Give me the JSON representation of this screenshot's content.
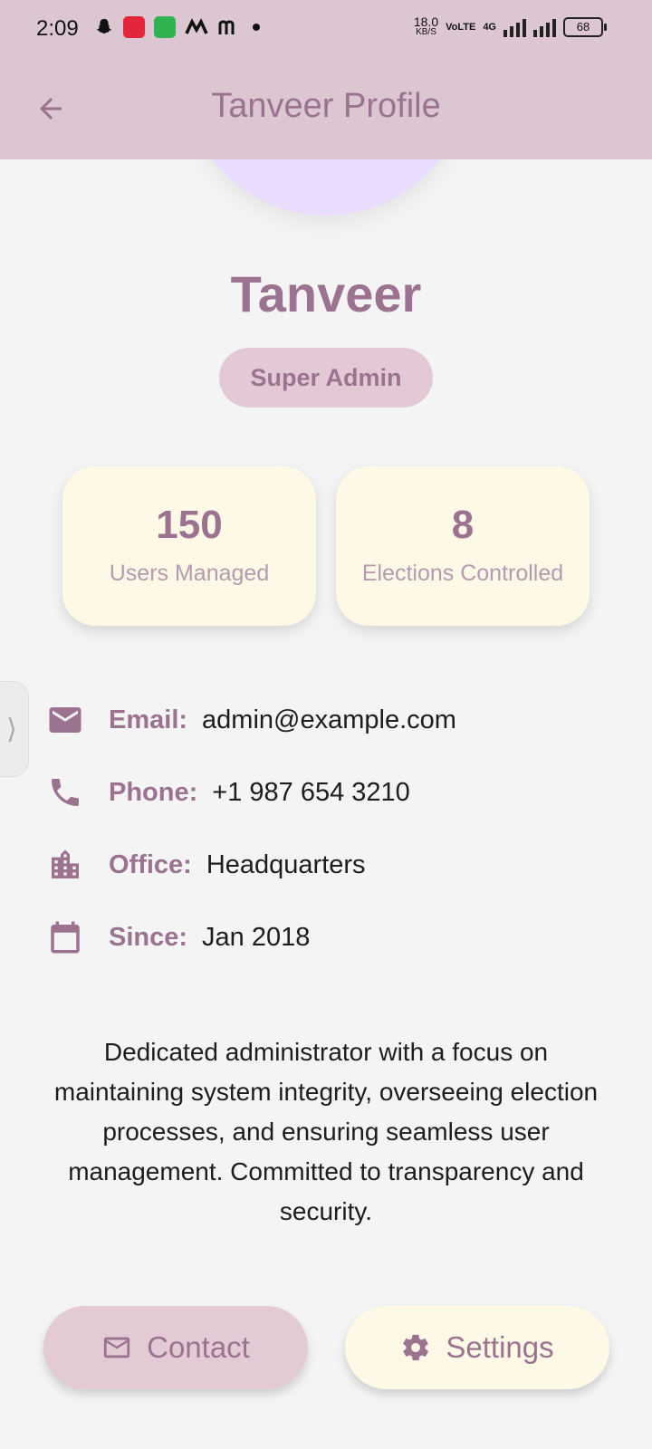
{
  "status_bar": {
    "time": "2:09",
    "speed": "18.0",
    "speed_unit": "KB/S",
    "volte": "VoLTE",
    "network": "4G",
    "battery": "68"
  },
  "app_bar": {
    "title": "Tanveer Profile",
    "background": "#dcc6d1"
  },
  "profile": {
    "name": "Tanveer",
    "role": "Super Admin"
  },
  "stats": [
    {
      "value": "150",
      "label": "Users Managed"
    },
    {
      "value": "8",
      "label": "Elections Controlled"
    }
  ],
  "info": [
    {
      "icon": "email-icon",
      "label": "Email:",
      "value": "admin@example.com"
    },
    {
      "icon": "phone-icon",
      "label": "Phone:",
      "value": "+1 987 654 3210"
    },
    {
      "icon": "office-building-icon",
      "label": "Office:",
      "value": "Headquarters"
    },
    {
      "icon": "calendar-icon",
      "label": "Since:",
      "value": "Jan 2018"
    }
  ],
  "bio": "Dedicated administrator with a focus on maintaining system integrity, overseeing election processes, and ensuring seamless user management. Committed to transparency and security.",
  "actions": {
    "contact_label": "Contact",
    "settings_label": "Settings"
  },
  "colors": {
    "accent": "#9b7390",
    "chip": "#e3c9d5",
    "card": "#fef8e6",
    "avatar": "#eadcfd",
    "background": "#f4f4f4"
  }
}
